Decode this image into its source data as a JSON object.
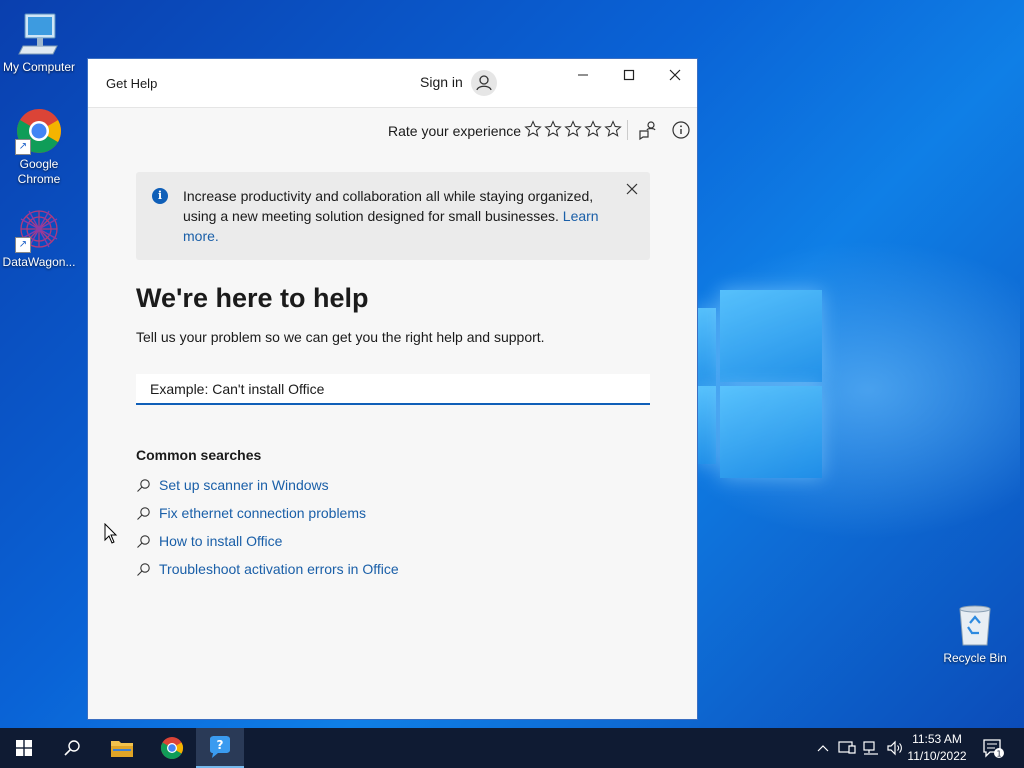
{
  "desktop": {
    "icons": [
      {
        "label": "My Computer"
      },
      {
        "label": "Google Chrome"
      },
      {
        "label": "DataWagon..."
      },
      {
        "label": "Recycle Bin"
      }
    ]
  },
  "window": {
    "title": "Get Help",
    "signin_label": "Sign in",
    "rate_label": "Rate your experience",
    "stars_total": 5,
    "banner": {
      "message": "Increase productivity and collaboration all while staying organized, using a new meeting solution designed for small businesses.",
      "link": "Learn more."
    },
    "heading": "We're here to help",
    "subheading": "Tell us your problem so we can get you the right help and support.",
    "search_placeholder": "Example: Can't install Office",
    "common_searches_title": "Common searches",
    "common_searches": [
      "Set up scanner in Windows",
      "Fix ethernet connection problems",
      "How to install Office",
      "Troubleshoot activation errors in Office"
    ]
  },
  "taskbar": {
    "time": "11:53 AM",
    "date": "11/10/2022",
    "notification_count": "1"
  },
  "colors": {
    "accent": "#0f5fb8",
    "link": "#1a5fa8",
    "taskbar": "#0f1b33"
  }
}
